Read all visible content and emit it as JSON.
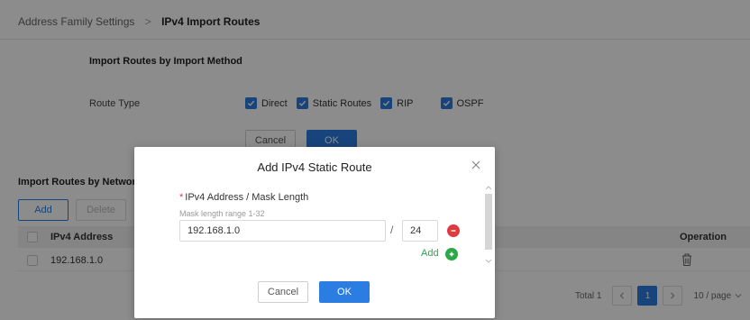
{
  "breadcrumb": {
    "parent": "Address Family Settings",
    "separator": ">",
    "current": "IPv4 Import Routes"
  },
  "import_by_method": {
    "title": "Import Routes by Import Method",
    "route_type_label": "Route Type",
    "options": [
      "Direct",
      "Static Routes",
      "RIP",
      "OSPF"
    ],
    "cancel_label": "Cancel",
    "ok_label": "OK"
  },
  "import_by_network": {
    "title": "Import Routes by Network",
    "add_label": "Add",
    "delete_label": "Delete",
    "columns": {
      "address": "IPv4 Address",
      "operation": "Operation"
    },
    "rows": [
      {
        "address": "192.168.1.0"
      }
    ]
  },
  "pager": {
    "total": "Total 1",
    "page": "1",
    "page_size": "10 / page"
  },
  "dialog": {
    "title": "Add IPv4 Static Route",
    "field_label": "IPv4 Address / Mask Length",
    "required_mark": "*",
    "hint": "Mask length range 1-32",
    "address_value": "192.168.1.0",
    "slash": "/",
    "mask_value": "24",
    "add_label": "Add",
    "cancel_label": "Cancel",
    "ok_label": "OK"
  },
  "colors": {
    "primary": "#2b7de1",
    "danger": "#e0393e",
    "success": "#2aa84a"
  },
  "icons": {
    "close": "close-icon",
    "remove": "minus-circle-icon",
    "add": "plus-circle-icon",
    "delete_row": "trash-icon",
    "check": "check-icon",
    "prev": "chevron-left-icon",
    "next": "chevron-right-icon",
    "dropdown": "chevron-down-icon"
  }
}
